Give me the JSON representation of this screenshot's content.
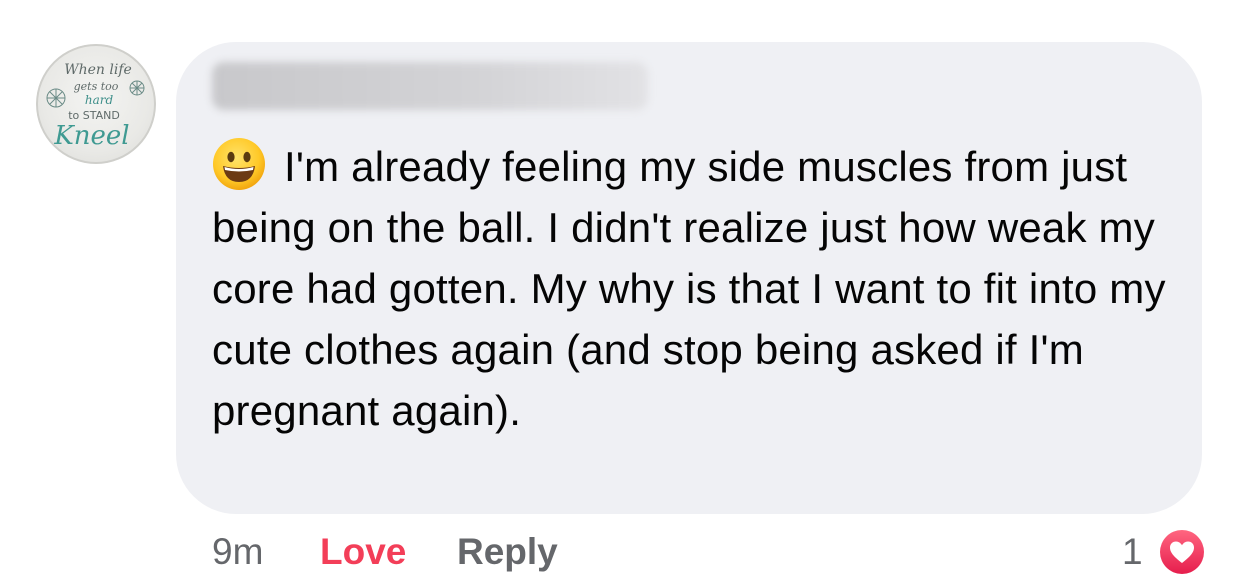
{
  "comment": {
    "avatar": {
      "icon": "profile-avatar-icon",
      "text_lines": [
        "When life",
        "gets too",
        "hard",
        "to STAND",
        "Kneel"
      ]
    },
    "author": "",
    "emoji": "grinning-face-icon",
    "text": "I'm already feeling my side muscles from just being on the ball. I didn't realize just how weak my core had gotten. My why is that I want to fit into my cute clothes again (and stop being asked if I'm pregnant again).",
    "bubble_color": "#eff0f4"
  },
  "footer": {
    "time": "9m",
    "love_label": "Love",
    "reply_label": "Reply",
    "reaction_count": "1",
    "reaction_icon": "heart-reaction-icon",
    "love_color": "#f33e58",
    "meta_color": "#65676b"
  }
}
